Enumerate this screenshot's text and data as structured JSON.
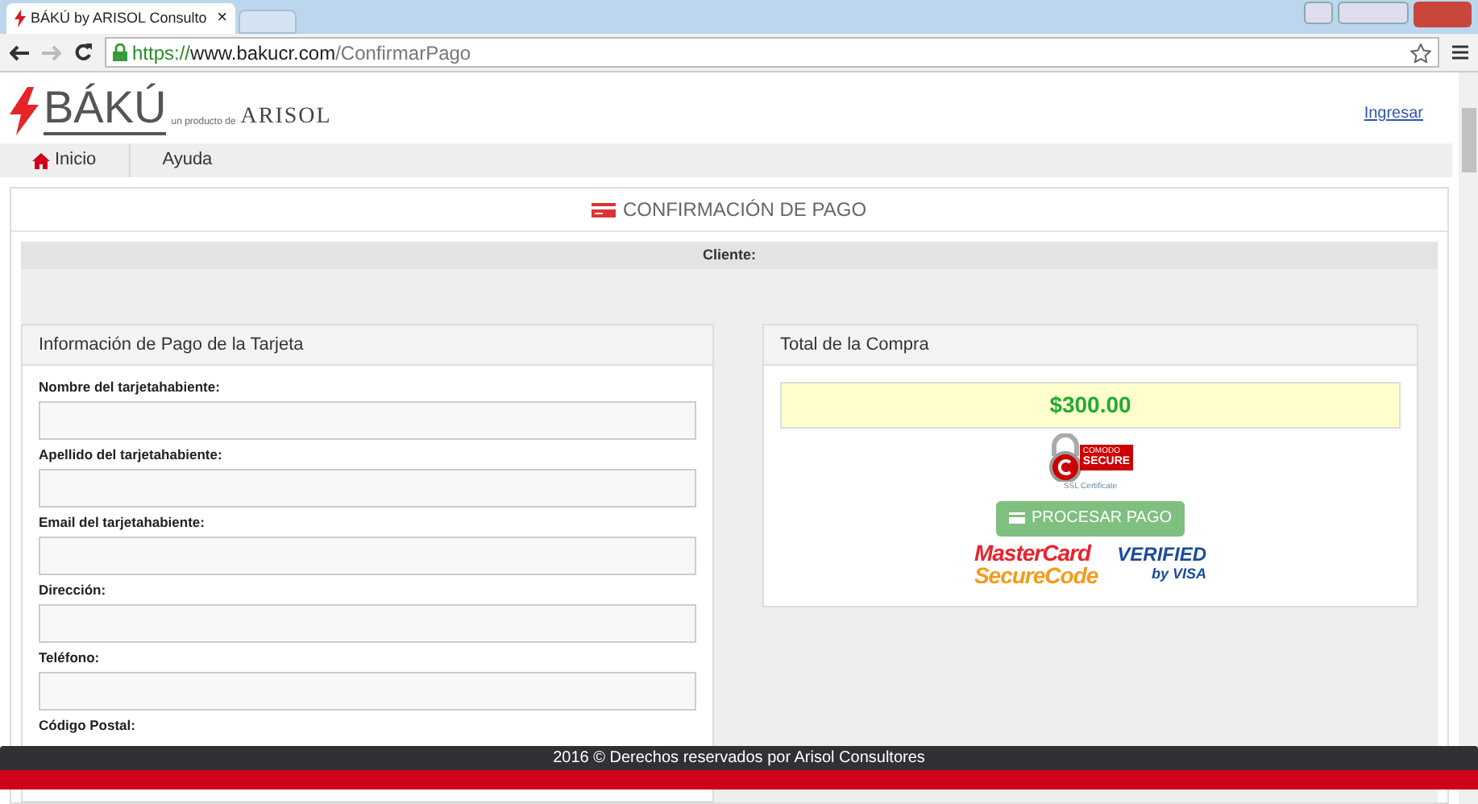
{
  "browser": {
    "tab_title": "BÁKÚ by ARISOL Consulto",
    "tab_close": "×",
    "url_scheme": "https://",
    "url_host": "www.bakucr.com",
    "url_path": "/ConfirmarPago"
  },
  "header": {
    "brand": "BÁKÚ",
    "tagline": "un producto de",
    "company": "ARISOL",
    "login_link": "Ingresar"
  },
  "nav": [
    {
      "label": "Inicio",
      "kind": "home"
    },
    {
      "label": "Ayuda",
      "kind": "plain"
    }
  ],
  "page_title": "CONFIRMACIÓN DE PAGO",
  "client_label": "Cliente:",
  "payment_panel": {
    "title": "Información de Pago de la Tarjeta",
    "fields": [
      {
        "label": "Nombre del tarjetahabiente:",
        "kind": "input"
      },
      {
        "label": "Apellido del tarjetahabiente:",
        "kind": "input"
      },
      {
        "label": "Email del tarjetahabiente:",
        "kind": "input"
      },
      {
        "label": "Dirección:",
        "kind": "input"
      },
      {
        "label": "Teléfono:",
        "kind": "input"
      },
      {
        "label": "Código Postal:",
        "kind": "label"
      }
    ]
  },
  "total_panel": {
    "title": "Total de la Compra",
    "amount": "$300.00",
    "seal": {
      "brand": "COMODO",
      "word": "SECURE",
      "caption": "SSL Certificate"
    },
    "button": "PROCESAR PAGO",
    "mastercard": {
      "line_1": "MasterCard",
      "line_2": "SecureCode"
    },
    "visa": {
      "line_1": "VERIFIED",
      "line_2": "by VISA"
    }
  },
  "footer": "2016 © Derechos reservados por Arisol Consultores"
}
